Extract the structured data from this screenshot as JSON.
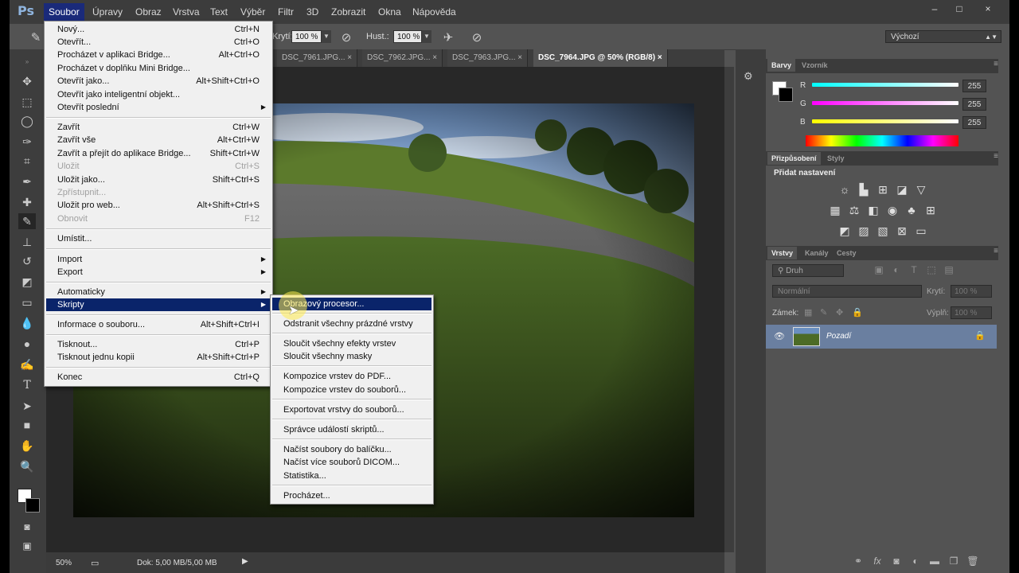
{
  "app": {
    "logo": "Ps",
    "menubar": [
      "Soubor",
      "Úpravy",
      "Obraz",
      "Vrstva",
      "Text",
      "Výběr",
      "Filtr",
      "3D",
      "Zobrazit",
      "Okna",
      "Nápověda"
    ],
    "window_controls": [
      "–",
      "□",
      "×"
    ]
  },
  "options_bar": {
    "opacity_label": "Krytí:",
    "opacity_value": "100 %",
    "flow_label": "Hust.:",
    "flow_value": "100 %",
    "workspace": "Výchozí"
  },
  "tabs": [
    {
      "label": "DSC_7961.JPG..."
    },
    {
      "label": "DSC_7962.JPG..."
    },
    {
      "label": "DSC_7963.JPG..."
    },
    {
      "label": "DSC_7964.JPG @ 50% (RGB/8)",
      "active": true
    }
  ],
  "status": {
    "zoom": "50%",
    "doc": "Dok: 5,00 MB/5,00 MB"
  },
  "file_menu": {
    "items": [
      {
        "label": "Nový...",
        "shortcut": "Ctrl+N"
      },
      {
        "label": "Otevřít...",
        "shortcut": "Ctrl+O"
      },
      {
        "label": "Procházet v aplikaci Bridge...",
        "shortcut": "Alt+Ctrl+O"
      },
      {
        "label": "Procházet v doplňku Mini Bridge...",
        "shortcut": ""
      },
      {
        "label": "Otevřít jako...",
        "shortcut": "Alt+Shift+Ctrl+O"
      },
      {
        "label": "Otevřít jako inteligentní objekt...",
        "shortcut": ""
      },
      {
        "label": "Otevřít poslední",
        "shortcut": ""
      },
      {
        "label": "Zavřít",
        "shortcut": "Ctrl+W"
      },
      {
        "label": "Zavřít vše",
        "shortcut": "Alt+Ctrl+W"
      },
      {
        "label": "Zavřít a přejít do aplikace Bridge...",
        "shortcut": "Shift+Ctrl+W"
      },
      {
        "label": "Uložit",
        "shortcut": "Ctrl+S"
      },
      {
        "label": "Uložit jako...",
        "shortcut": "Shift+Ctrl+S"
      },
      {
        "label": "Zpřístupnit...",
        "shortcut": ""
      },
      {
        "label": "Uložit pro web...",
        "shortcut": "Alt+Shift+Ctrl+S"
      },
      {
        "label": "Obnovit",
        "shortcut": "F12"
      },
      {
        "label": "Umístit...",
        "shortcut": ""
      },
      {
        "label": "Import",
        "shortcut": ""
      },
      {
        "label": "Export",
        "shortcut": ""
      },
      {
        "label": "Automaticky",
        "shortcut": ""
      },
      {
        "label": "Skripty",
        "shortcut": ""
      },
      {
        "label": "Informace o souboru...",
        "shortcut": "Alt+Shift+Ctrl+I"
      },
      {
        "label": "Tisknout...",
        "shortcut": "Ctrl+P"
      },
      {
        "label": "Tisknout jednu kopii",
        "shortcut": "Alt+Shift+Ctrl+P"
      },
      {
        "label": "Konec",
        "shortcut": "Ctrl+Q"
      }
    ]
  },
  "scripts_menu": {
    "items": [
      "Obrazový procesor...",
      "Odstranit všechny prázdné vrstvy",
      "Sloučit všechny efekty vrstev",
      "Sloučit všechny masky",
      "Kompozice vrstev do PDF...",
      "Kompozice vrstev do souborů...",
      "Exportovat vrstvy do souborů...",
      "Správce událostí skriptů...",
      "Načíst soubory do balíčku...",
      "Načíst více souborů DICOM...",
      "Statistika...",
      "Procházet..."
    ]
  },
  "color_panel": {
    "tabs": [
      "Barvy",
      "Vzorník"
    ],
    "r_label": "R",
    "g_label": "G",
    "b_label": "B",
    "r": "255",
    "g": "255",
    "b": "255"
  },
  "adjustments_panel": {
    "tabs": [
      "Přizpůsobení",
      "Styly"
    ],
    "title": "Přidat nastavení"
  },
  "layers_panel": {
    "tabs": [
      "Vrstvy",
      "Kanály",
      "Cesty"
    ],
    "kind": "Druh",
    "blend": "Normální",
    "opacity_label": "Krytí:",
    "opacity": "100 %",
    "lock_label": "Zámek:",
    "fill_label": "Výplň:",
    "fill": "100 %",
    "layer_name": "Pozadí"
  },
  "colors": {
    "menu_highlight": "#0a246a",
    "layer_selected": "#6a7fa0",
    "tab_active": "#535353"
  }
}
